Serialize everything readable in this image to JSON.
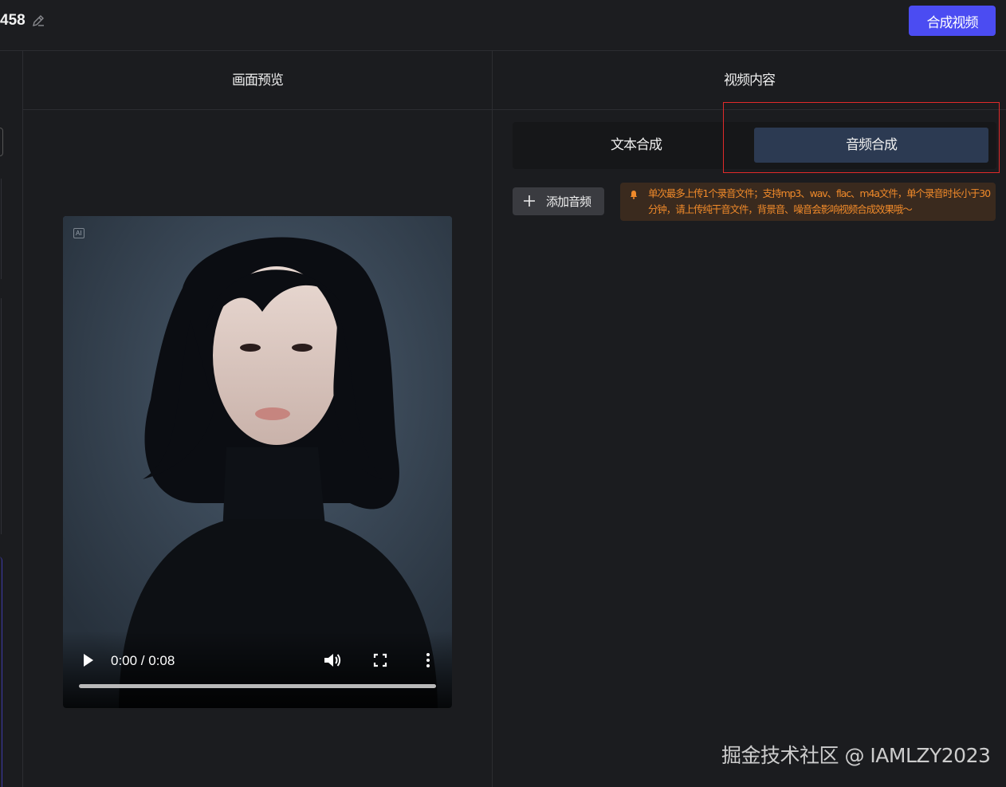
{
  "header": {
    "project_title": "458",
    "compose_button": "合成视频"
  },
  "preview": {
    "title": "画面预览",
    "ai_badge": "AI",
    "player": {
      "time": "0:00 / 0:08",
      "progress": 0
    }
  },
  "content": {
    "title": "视频内容",
    "tabs": [
      {
        "label": "文本合成",
        "active": false
      },
      {
        "label": "音频合成",
        "active": true
      }
    ],
    "add_audio_button": "添加音频",
    "notice": "单次最多上传1个录音文件；支持mp3、wav、flac、m4a文件，单个录音时长小于30分钟，请上传纯干音文件，背景音、噪音会影响视频合成效果哦～"
  },
  "watermark": "掘金技术社区 @ IAMLZY2023",
  "colors": {
    "accent": "#4b4cf2",
    "active_tab": "#2c3a52",
    "notice_text": "#f08a2a",
    "highlight_box": "#e02a2a"
  },
  "icons": [
    "edit-icon",
    "play-icon",
    "volume-icon",
    "fullscreen-icon",
    "more-icon",
    "plus-icon",
    "bell-icon"
  ]
}
